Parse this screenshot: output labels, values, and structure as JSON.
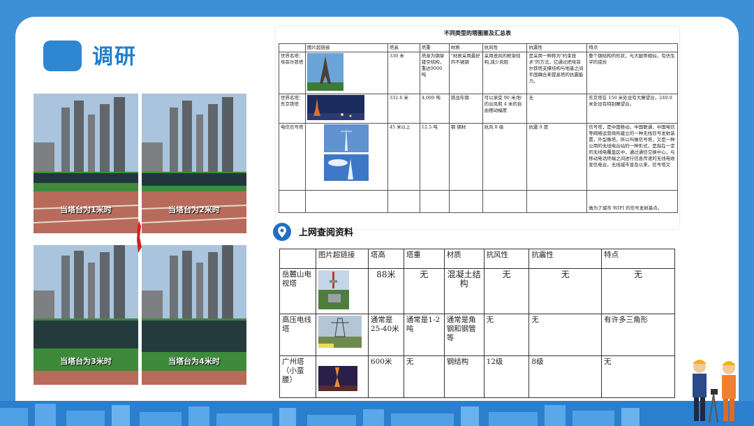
{
  "title": "调研",
  "photos": [
    {
      "caption": "当塔台为1米时"
    },
    {
      "caption": "当塔台为2米时"
    },
    {
      "caption": "当塔台为3米时"
    },
    {
      "caption": "当塔台为4米时"
    }
  ],
  "table1": {
    "title": "不同类型的塔图鉴及汇总表",
    "headers": [
      "",
      "图片超链接",
      "塔高",
      "塔重",
      "材质",
      "抗风性",
      "抗震性",
      "特点"
    ],
    "rows": [
      {
        "name": "世界名塔：埃菲尔铁塔",
        "height": "330 米",
        "weight": "塔身为钢架镂空结构，重达9000 吨",
        "material": "\"材质采用最好的不锈钢",
        "wind": "采用透风的框架结构,减少风阻",
        "quake": "是采用一种称为\"约束技术\"的方法，它通过把埃菲尔铁塔支撑结构与地基之间平固耦合来提高塔的抗震能力。",
        "feature": "整个钢结构的形状，与大腿骨相似，有仿生学的成份"
      },
      {
        "name": "世界名塔：东京铁塔",
        "height": "332.6 米",
        "weight": "4,000 吨",
        "material": "铁战车钢",
        "wind": "可以承受 90 米/秒的台风和 4 米的自由摆动幅度",
        "quake": "无",
        "feature": "东京塔在 150 米处设有大瞭望台，249.9 米处设有特别瞭望台。"
      },
      {
        "name": "电信信号塔",
        "height": "45 米以上",
        "weight": "12.5 吨",
        "material": "钢 钢材",
        "wind": "抗风 8 级",
        "quake": "抗震 9 度",
        "feature": "信号塔，是中国移动，中国联通，中国电信等网络运营商所建立的一种无线信号发射装置，外型像塔，所以叫做信号塔，又是一种公用的无线电台站的一种形式，是指在一定的无线电覆盖区中，通过通信交换中心，与移动电话终端之间进行信息传递的无线电收发信电台。无线城市普及以来，信号塔又"
      },
      {
        "name": "",
        "height": "",
        "weight": "",
        "material": "",
        "wind": "",
        "quake": "",
        "feature": "做为了城市 WIFI 的信号发射基点。"
      }
    ]
  },
  "web_section": {
    "label": "上网查阅资料"
  },
  "table2": {
    "headers": [
      "",
      "图片超链接",
      "塔高",
      "塔重",
      "材质",
      "抗风性",
      "抗震性",
      "特点"
    ],
    "rows": [
      {
        "name": "岳麓山电视塔",
        "height": "88米",
        "weight": "无",
        "material": "混凝土结构",
        "wind": "无",
        "quake": "无",
        "feature": "无"
      },
      {
        "name": "高压电线塔",
        "height": "通常是25-40米",
        "weight": "通常是1-2吨",
        "material": "通常是角钢和钢管等",
        "wind": "无",
        "quake": "无",
        "feature": "有许多三角形"
      },
      {
        "name": "广州塔（小蛮腰）",
        "height": "600米",
        "weight": "无",
        "material": "钢结构",
        "wind": "12级",
        "quake": "8级",
        "feature": "无"
      }
    ]
  },
  "colors": {
    "accent": "#2f86d2",
    "frame": "#3d8fd6"
  }
}
